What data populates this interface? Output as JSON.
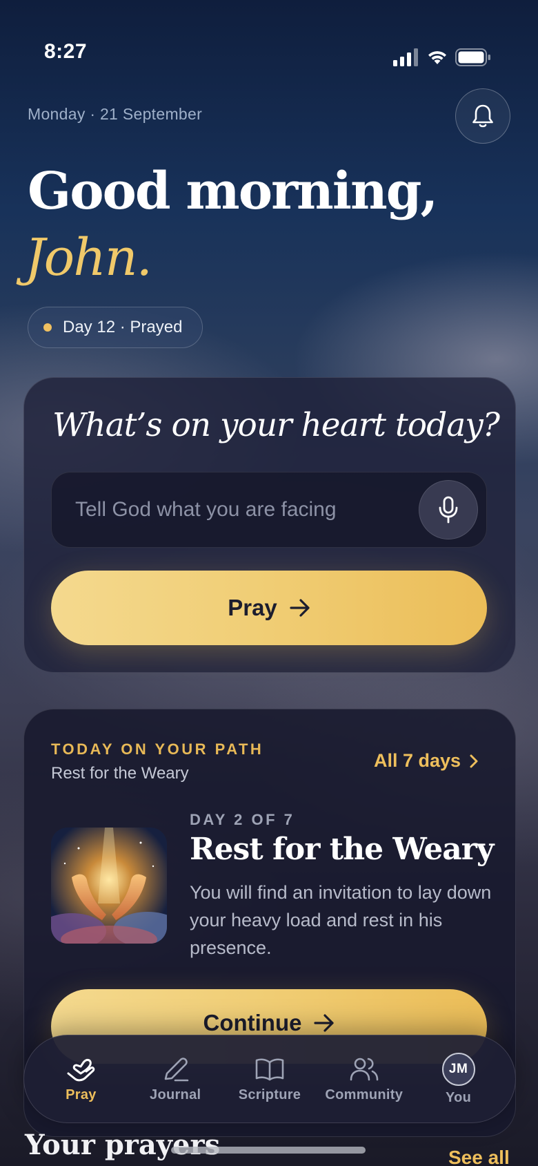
{
  "status_bar": {
    "time": "8:27"
  },
  "header": {
    "date": "Monday · 21 September",
    "greeting_line1": "Good morning,",
    "greeting_name": "John.",
    "streak": "Day 12 · Prayed"
  },
  "prayer_card": {
    "heading": "What’s on your heart today?",
    "input_placeholder": "Tell God what you are facing",
    "input_value": "",
    "button_label": "Pray"
  },
  "path_card": {
    "eyebrow": "TODAY ON YOUR PATH",
    "path_name": "Rest for the Weary",
    "all_days_link": "All 7 days",
    "day_label": "DAY 2 OF 7",
    "title": "Rest for the Weary",
    "description": "You will find an invitation to lay down your heavy load and rest in his presence.",
    "button_label": "Continue"
  },
  "prayers_section": {
    "title": "Your prayers",
    "see_all": "See all"
  },
  "tab_bar": {
    "items": [
      {
        "label": "Pray",
        "icon": "praying-hands-icon",
        "active": true
      },
      {
        "label": "Journal",
        "icon": "pencil-icon",
        "active": false
      },
      {
        "label": "Scripture",
        "icon": "open-book-icon",
        "active": false
      },
      {
        "label": "Community",
        "icon": "people-icon",
        "active": false
      },
      {
        "label": "You",
        "icon": "avatar",
        "active": false
      }
    ],
    "avatar_initials": "JM"
  },
  "colors": {
    "accent_gold": "#eebf5c",
    "name_gold": "#f0c96a",
    "card_bg": "#18192d"
  }
}
